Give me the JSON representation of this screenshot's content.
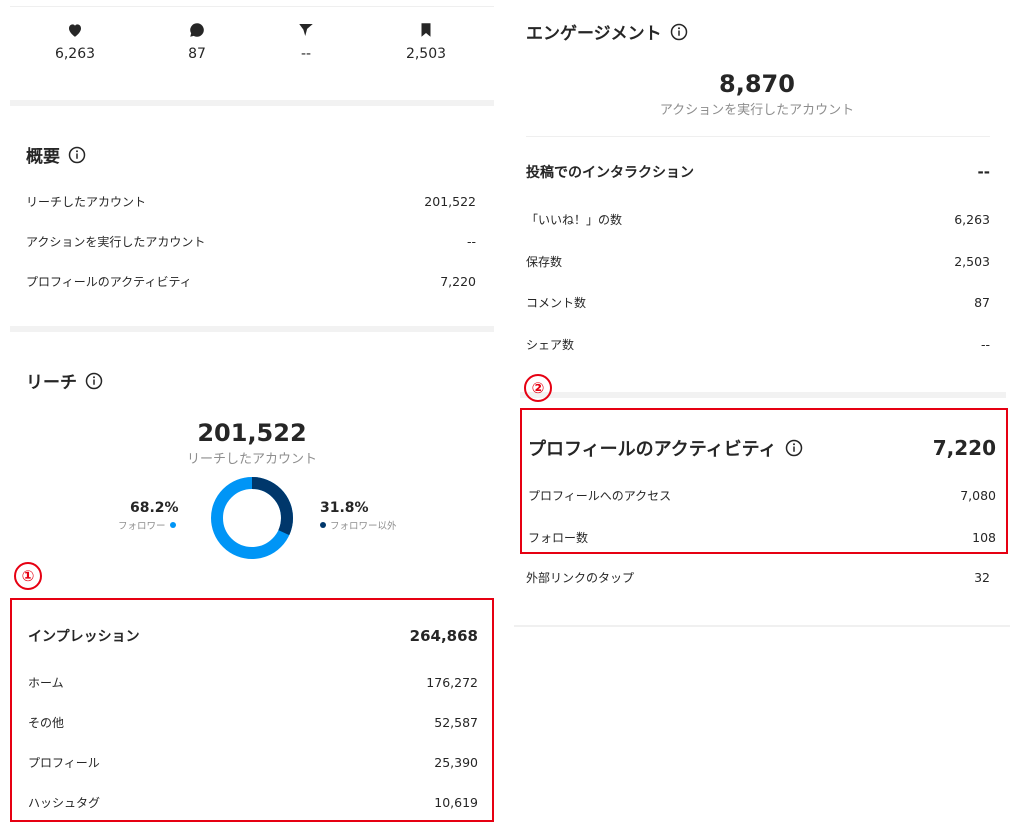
{
  "colors": {
    "followers": "#0095f6",
    "non_followers": "#00376b",
    "annotation": "#e60012"
  },
  "top_stats": [
    {
      "icon": "heart-icon",
      "value": "6,263"
    },
    {
      "icon": "comment-icon",
      "value": "87"
    },
    {
      "icon": "share-icon",
      "value": "--"
    },
    {
      "icon": "bookmark-icon",
      "value": "2,503"
    }
  ],
  "overview": {
    "title": "概要",
    "rows": [
      {
        "label": "リーチしたアカウント",
        "value": "201,522"
      },
      {
        "label": "アクションを実行したアカウント",
        "value": "--"
      },
      {
        "label": "プロフィールのアクティビティ",
        "value": "7,220"
      }
    ]
  },
  "reach": {
    "title": "リーチ",
    "total": "201,522",
    "total_label": "リーチしたアカウント",
    "followers_pct": "68.2%",
    "followers_label": "フォロワー",
    "followers_fraction": 0.682,
    "non_followers_pct": "31.8%",
    "non_followers_label": "フォロワー以外"
  },
  "impressions": {
    "marker": "①",
    "title": "インプレッション",
    "total": "264,868",
    "rows": [
      {
        "label": "ホーム",
        "value": "176,272"
      },
      {
        "label": "その他",
        "value": "52,587"
      },
      {
        "label": "プロフィール",
        "value": "25,390"
      },
      {
        "label": "ハッシュタグ",
        "value": "10,619"
      }
    ]
  },
  "engagement": {
    "title": "エンゲージメント",
    "total": "8,870",
    "total_label": "アクションを実行したアカウント",
    "interactions_title": "投稿でのインタラクション",
    "interactions_value": "--",
    "rows": [
      {
        "label": "「いいね！」の数",
        "value": "6,263"
      },
      {
        "label": "保存数",
        "value": "2,503"
      },
      {
        "label": "コメント数",
        "value": "87"
      },
      {
        "label": "シェア数",
        "value": "--"
      }
    ]
  },
  "profile_activity": {
    "marker": "②",
    "title": "プロフィールのアクティビティ",
    "total": "7,220",
    "rows": [
      {
        "label": "プロフィールへのアクセス",
        "value": "7,080"
      },
      {
        "label": "フォロー数",
        "value": "108"
      }
    ],
    "extra_row": {
      "label": "外部リンクのタップ",
      "value": "32"
    }
  }
}
